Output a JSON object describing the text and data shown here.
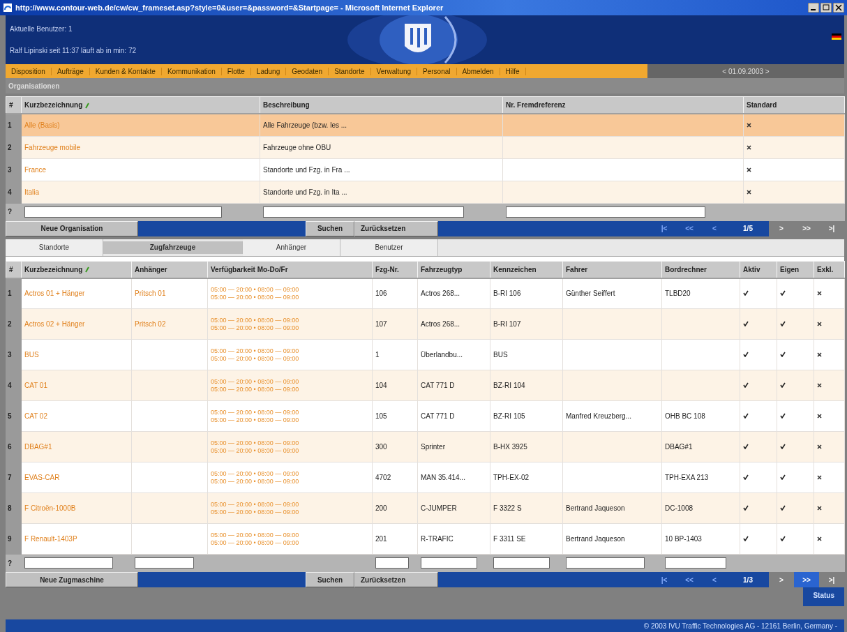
{
  "window": {
    "title": "http://www.contour-web.de/cw/cw_frameset.asp?style=0&user=&password=&Startpage= - Microsoft Internet Explorer"
  },
  "header": {
    "users": "Aktuelle Benutzer: 1",
    "session": "Ralf Lipinski seit 11:37 läuft ab in min: 72"
  },
  "menu": [
    {
      "label": "Disposition"
    },
    {
      "label": "Aufträge"
    },
    {
      "label": "Kunden & Kontakte"
    },
    {
      "label": "Kommunikation"
    },
    {
      "label": "Flotte"
    },
    {
      "label": "Ladung"
    },
    {
      "label": "Geodaten"
    },
    {
      "label": "Standorte"
    },
    {
      "label": "Verwaltung"
    },
    {
      "label": "Personal"
    },
    {
      "label": "Abmelden"
    },
    {
      "label": "Hilfe"
    }
  ],
  "date": "< 01.09.2003 >",
  "organisations": {
    "title": "Organisationen",
    "columns": [
      {
        "label": "#",
        "sorted": false,
        "filter": false
      },
      {
        "label": "Kurzbezeichnung",
        "sorted": true,
        "filter": true
      },
      {
        "label": "Beschreibung",
        "sorted": false,
        "filter": true
      },
      {
        "label": "Nr. Fremdreferenz",
        "sorted": false,
        "filter": true
      },
      {
        "label": "Standard",
        "sorted": false,
        "filter": false
      }
    ],
    "rows": [
      {
        "number": "1",
        "short_name": "Alle (Basis)",
        "description": "Alle Fahrzeuge (bzw. les ...",
        "standard": false,
        "selected": true
      },
      {
        "number": "2",
        "short_name": "Fahrzeuge mobile",
        "description": "Fahrzeuge ohne OBU",
        "standard": false,
        "selected": false
      },
      {
        "number": "3",
        "short_name": "France",
        "description": "Standorte und Fzg. in Fra ...",
        "standard": false,
        "selected": false
      },
      {
        "number": "4",
        "short_name": "Italia",
        "description": "Standorte und Fzg. in Ita ...",
        "standard": false,
        "selected": false
      }
    ],
    "filter_marker": "?",
    "buttons": {
      "new": "Neue Organisation",
      "search": "Suchen",
      "reset": "Zurücksetzen"
    },
    "pager": [
      {
        "label": "|<",
        "kind": "button",
        "selected": false
      },
      {
        "label": "<<",
        "kind": "button",
        "selected": false
      },
      {
        "label": "<",
        "kind": "button",
        "selected": false
      },
      {
        "label": "1/5",
        "kind": "page",
        "selected": false
      },
      {
        "label": ">",
        "kind": "button",
        "selected": false
      },
      {
        "label": ">>",
        "kind": "button",
        "selected": false
      },
      {
        "label": ">|",
        "kind": "button",
        "selected": false
      }
    ]
  },
  "tabs": [
    {
      "label": "Standorte",
      "selected": false
    },
    {
      "label": "Zugfahrzeuge",
      "selected": true
    },
    {
      "label": "Anhänger",
      "selected": false
    },
    {
      "label": "Benutzer",
      "selected": false
    }
  ],
  "vehicles": {
    "columns": [
      {
        "label": "#",
        "sorted": false,
        "filter": false
      },
      {
        "label": "Kurzbezeichnung",
        "sorted": true,
        "filter": true
      },
      {
        "label": "Anhänger",
        "sorted": false,
        "filter": true
      },
      {
        "label": "Verfügbarkeit Mo-Do/Fr",
        "sorted": false,
        "filter": false
      },
      {
        "label": "Fzg-Nr.",
        "sorted": false,
        "filter": true
      },
      {
        "label": "Fahrzeugtyp",
        "sorted": false,
        "filter": true
      },
      {
        "label": "Kennzeichen",
        "sorted": false,
        "filter": true
      },
      {
        "label": "Fahrer",
        "sorted": false,
        "filter": true
      },
      {
        "label": "Bordrechner",
        "sorted": false,
        "filter": true
      },
      {
        "label": "Aktiv",
        "sorted": false,
        "filter": false
      },
      {
        "label": "Eigen",
        "sorted": false,
        "filter": false
      },
      {
        "label": "Exkl.",
        "sorted": false,
        "filter": false
      }
    ],
    "rows": [
      {
        "number": "1",
        "short_name": "Actros 01 + Hänger",
        "trailer": "Pritsch 01",
        "availability": [
          "05:00 — 20:00 • 08:00 — 09:00",
          "05:00 — 20:00 • 08:00 — 09:00"
        ],
        "vehicle_no": "106",
        "type": "Actros 268...",
        "plate": "B-RI 106",
        "driver": "Günther Seiffert",
        "board_computer": "TLBD20",
        "active": true,
        "own": true,
        "exclusive": false
      },
      {
        "number": "2",
        "short_name": "Actros 02 + Hänger",
        "trailer": "Pritsch 02",
        "availability": [
          "05:00 — 20:00 • 08:00 — 09:00",
          "05:00 — 20:00 • 08:00 — 09:00"
        ],
        "vehicle_no": "107",
        "type": "Actros 268...",
        "plate": "B-RI 107",
        "active": true,
        "own": true,
        "exclusive": false
      },
      {
        "number": "3",
        "short_name": "BUS",
        "availability": [
          "05:00 — 20:00 • 08:00 — 09:00",
          "05:00 — 20:00 • 08:00 — 09:00"
        ],
        "vehicle_no": "1",
        "type": "Überlandbu...",
        "plate": "BUS",
        "active": true,
        "own": true,
        "exclusive": false
      },
      {
        "number": "4",
        "short_name": "CAT 01",
        "availability": [
          "05:00 — 20:00 • 08:00 — 09:00",
          "05:00 — 20:00 • 08:00 — 09:00"
        ],
        "vehicle_no": "104",
        "type": "CAT 771 D",
        "plate": "BZ-RI 104",
        "active": true,
        "own": true,
        "exclusive": false
      },
      {
        "number": "5",
        "short_name": "CAT 02",
        "availability": [
          "05:00 — 20:00 • 08:00 — 09:00",
          "05:00 — 20:00 • 08:00 — 09:00"
        ],
        "vehicle_no": "105",
        "type": "CAT 771 D",
        "plate": "BZ-RI 105",
        "driver": "Manfred Kreuzberg...",
        "board_computer": "OHB BC 108",
        "active": true,
        "own": true,
        "exclusive": false
      },
      {
        "number": "6",
        "short_name": "DBAG#1",
        "availability": [
          "05:00 — 20:00 • 08:00 — 09:00",
          "05:00 — 20:00 • 08:00 — 09:00"
        ],
        "vehicle_no": "300",
        "type": "Sprinter",
        "plate": "B-HX 3925",
        "board_computer": "DBAG#1",
        "active": true,
        "own": true,
        "exclusive": false
      },
      {
        "number": "7",
        "short_name": "EVAS-CAR",
        "availability": [
          "05:00 — 20:00 • 08:00 — 09:00",
          "05:00 — 20:00 • 08:00 — 09:00"
        ],
        "vehicle_no": "4702",
        "type": "MAN 35.414...",
        "plate": "TPH-EX-02",
        "board_computer": "TPH-EXA 213",
        "active": true,
        "own": true,
        "exclusive": false
      },
      {
        "number": "8",
        "short_name": "F Citroën-1000B",
        "availability": [
          "05:00 — 20:00 • 08:00 — 09:00",
          "05:00 — 20:00 • 08:00 — 09:00"
        ],
        "vehicle_no": "200",
        "type": "C-JUMPER",
        "plate": "F 3322 S",
        "driver": "Bertrand Jaqueson",
        "board_computer": "DC-1008",
        "active": true,
        "own": true,
        "exclusive": false
      },
      {
        "number": "9",
        "short_name": "F Renault-1403P",
        "availability": [
          "05:00 — 20:00 • 08:00 — 09:00",
          "05:00 — 20:00 • 08:00 — 09:00"
        ],
        "vehicle_no": "201",
        "type": "R-TRAFIC",
        "plate": "F 3311 SE",
        "driver": "Bertrand Jaqueson",
        "board_computer": "10 BP-1403",
        "active": true,
        "own": true,
        "exclusive": false
      }
    ],
    "filter_marker": "?",
    "buttons": {
      "new": "Neue Zugmaschine",
      "search": "Suchen",
      "reset": "Zurücksetzen"
    },
    "pager": [
      {
        "label": "|<",
        "kind": "button",
        "selected": false
      },
      {
        "label": "<<",
        "kind": "button",
        "selected": false
      },
      {
        "label": "<",
        "kind": "button",
        "selected": false
      },
      {
        "label": "1/3",
        "kind": "page",
        "selected": false
      },
      {
        "label": ">",
        "kind": "button",
        "selected": false
      },
      {
        "label": ">>",
        "kind": "button",
        "selected": true
      },
      {
        "label": ">|",
        "kind": "button",
        "selected": false
      }
    ]
  },
  "status": "Status",
  "footer": "© 2003 IVU Traffic Technologies AG - 12161 Berlin, Germany -"
}
